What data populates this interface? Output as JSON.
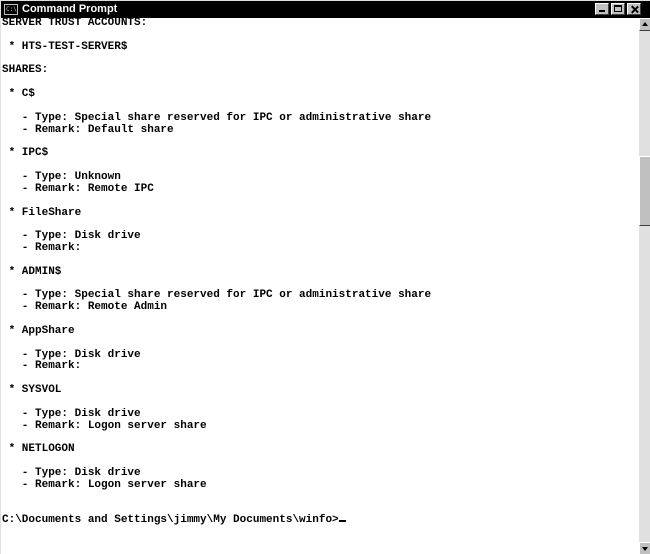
{
  "window": {
    "title": "Command Prompt",
    "icon_text": "C:\\",
    "icon_name": "cmd-icon"
  },
  "colors": {
    "titlebar_bg": "#000000",
    "titlebar_text": "#ffffff",
    "console_bg": "#ffffff",
    "console_text": "#000000"
  },
  "console": {
    "lines": [
      "SERVER TRUST ACCOUNTS:",
      "",
      " * HTS-TEST-SERVER$",
      "",
      "SHARES:",
      "",
      " * C$",
      "",
      "   - Type: Special share reserved for IPC or administrative share",
      "   - Remark: Default share",
      "",
      " * IPC$",
      "",
      "   - Type: Unknown",
      "   - Remark: Remote IPC",
      "",
      " * FileShare",
      "",
      "   - Type: Disk drive",
      "   - Remark:",
      "",
      " * ADMIN$",
      "",
      "   - Type: Special share reserved for IPC or administrative share",
      "   - Remark: Remote Admin",
      "",
      " * AppShare",
      "",
      "   - Type: Disk drive",
      "   - Remark:",
      "",
      " * SYSVOL",
      "",
      "   - Type: Disk drive",
      "   - Remark: Logon server share",
      "",
      " * NETLOGON",
      "",
      "   - Type: Disk drive",
      "   - Remark: Logon server share",
      "",
      ""
    ],
    "prompt": "C:\\Documents and Settings\\jimmy\\My Documents\\winfo>"
  }
}
